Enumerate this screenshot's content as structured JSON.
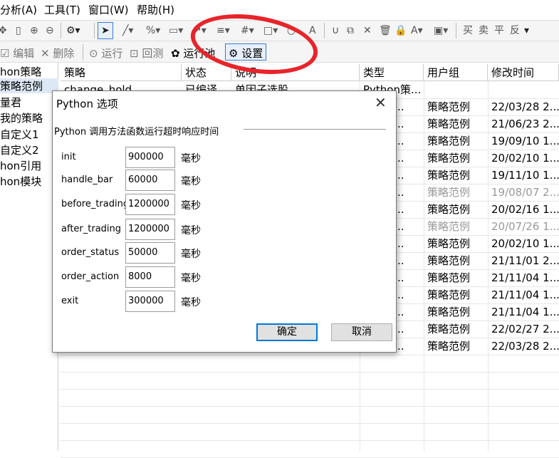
{
  "menubar": {
    "items": [
      "分析(A)",
      "工具(T)",
      "窗口(W)",
      "帮助(H)"
    ]
  },
  "toolbar1": {
    "icons": [
      "move-icon",
      "ruler-icon",
      "zoom-in-icon",
      "zoom-out-icon",
      "gear-icon",
      "pointer-icon",
      "line-icon",
      "percent-icon",
      "ruler-h-icon",
      "arrow-icon",
      "list-icon",
      "grid-icon",
      "rect-icon",
      "circle-icon",
      "text-icon",
      "magnet-icon",
      "copy-icon",
      "delete-icon",
      "trash-icon",
      "lock-icon",
      "font-color-icon",
      "save-icon"
    ],
    "trade_labels": [
      "买",
      "卖",
      "平",
      "反"
    ]
  },
  "toolbar2": {
    "edit": "编辑",
    "delete": "删除",
    "run": "运行",
    "backtest": "回测",
    "run_pool": "运行池",
    "settings": "设置"
  },
  "sidebar": {
    "items": [
      "hon策略",
      "策略范例",
      "量君",
      "我的策略",
      "自定义1",
      "自定义2",
      "hon引用",
      "hon模块"
    ],
    "selected_index": 1
  },
  "grid": {
    "columns": [
      "策略",
      "状态",
      "说明",
      "类型",
      "用户组",
      "修改时间"
    ],
    "visible_partial": [
      "change_hold",
      "已编译",
      "单因子选股",
      "Python策..."
    ],
    "rows": [
      {
        "type": "hon策...",
        "group": "策略范例",
        "time": "22/03/28 2...",
        "gray": false
      },
      {
        "type": "hon策...",
        "group": "策略范例",
        "time": "21/06/23 2...",
        "gray": false
      },
      {
        "type": "hon策...",
        "group": "策略范例",
        "time": "19/09/10 1...",
        "gray": false
      },
      {
        "type": "hon策...",
        "group": "策略范例",
        "time": "20/02/10 1...",
        "gray": false
      },
      {
        "type": "hon策...",
        "group": "策略范例",
        "time": "19/11/10 1...",
        "gray": false
      },
      {
        "type": "hon策...",
        "group": "策略范例",
        "time": "19/08/07 2...",
        "gray": true
      },
      {
        "type": "hon策...",
        "group": "策略范例",
        "time": "20/02/16 1...",
        "gray": false
      },
      {
        "type": "hon策...",
        "group": "策略范例",
        "time": "20/07/26 1...",
        "gray": true
      },
      {
        "type": "hon策...",
        "group": "策略范例",
        "time": "20/02/10 1...",
        "gray": false
      },
      {
        "type": "hon策...",
        "group": "策略范例",
        "time": "21/11/01 2...",
        "gray": false
      },
      {
        "type": "hon策...",
        "group": "策略范例",
        "time": "21/11/04 1...",
        "gray": false
      },
      {
        "type": "hon策...",
        "group": "策略范例",
        "time": "21/11/04 1...",
        "gray": false
      },
      {
        "type": "hon策...",
        "group": "策略范例",
        "time": "21/11/04 1...",
        "gray": false
      },
      {
        "type": "hon策...",
        "group": "策略范例",
        "time": "22/02/27 2...",
        "gray": false
      },
      {
        "type": "hon策...",
        "group": "策略范例",
        "time": "22/03/28 2...",
        "gray": false
      }
    ]
  },
  "dialog": {
    "title": "Python 选项",
    "close": "✕",
    "section": "Python 调用方法函数运行超时响应时间",
    "unit": "毫秒",
    "fields": [
      {
        "label": "init",
        "value": "900000"
      },
      {
        "label": "handle_bar",
        "value": "60000"
      },
      {
        "label": "before_trading",
        "value": "1200000"
      },
      {
        "label": "after_trading",
        "value": "1200000"
      },
      {
        "label": "order_status",
        "value": "50000"
      },
      {
        "label": "order_action",
        "value": "8000"
      },
      {
        "label": "exit",
        "value": "300000"
      }
    ],
    "ok": "确定",
    "cancel": "取消"
  },
  "colors": {
    "annotation_red": "#e8242b",
    "selection_blue": "#3a7bd5"
  }
}
